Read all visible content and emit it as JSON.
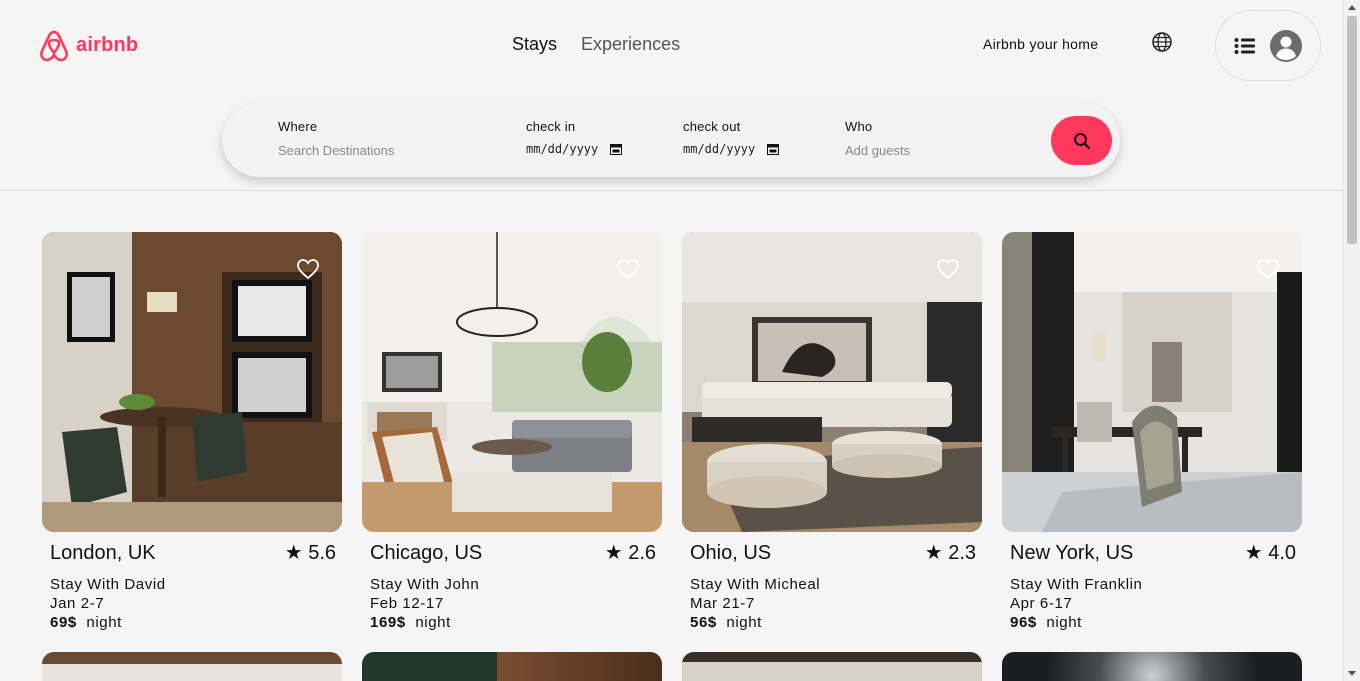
{
  "header": {
    "logo_text": "airbnb",
    "tabs": [
      {
        "label": "Stays",
        "active": true
      },
      {
        "label": "Experiences",
        "active": false
      }
    ],
    "host_link": "Airbnb your home",
    "brand_color": "#ff385c"
  },
  "search": {
    "where_label": "Where",
    "where_placeholder": "Search Destinations",
    "checkin_label": "check in",
    "checkin_value": "mm/dd/yyyy",
    "checkout_label": "check out",
    "checkout_value": "mm/dd/yyyy",
    "who_label": "Who",
    "who_placeholder": "Add guests"
  },
  "listings": [
    {
      "location": "London, UK",
      "rating": "★ 5.6",
      "host": "Stay With David",
      "dates": "Jan 2-7",
      "price": "69$",
      "unit": "night"
    },
    {
      "location": "Chicago, US",
      "rating": "★ 2.6",
      "host": "Stay With John",
      "dates": "Feb 12-17",
      "price": "169$",
      "unit": "night"
    },
    {
      "location": "Ohio, US",
      "rating": "★ 2.3",
      "host": "Stay With Micheal",
      "dates": "Mar 21-7",
      "price": "56$",
      "unit": "night"
    },
    {
      "location": "New York, US",
      "rating": "★ 4.0",
      "host": "Stay With Franklin",
      "dates": "Apr 6-17",
      "price": "96$",
      "unit": "night"
    }
  ]
}
